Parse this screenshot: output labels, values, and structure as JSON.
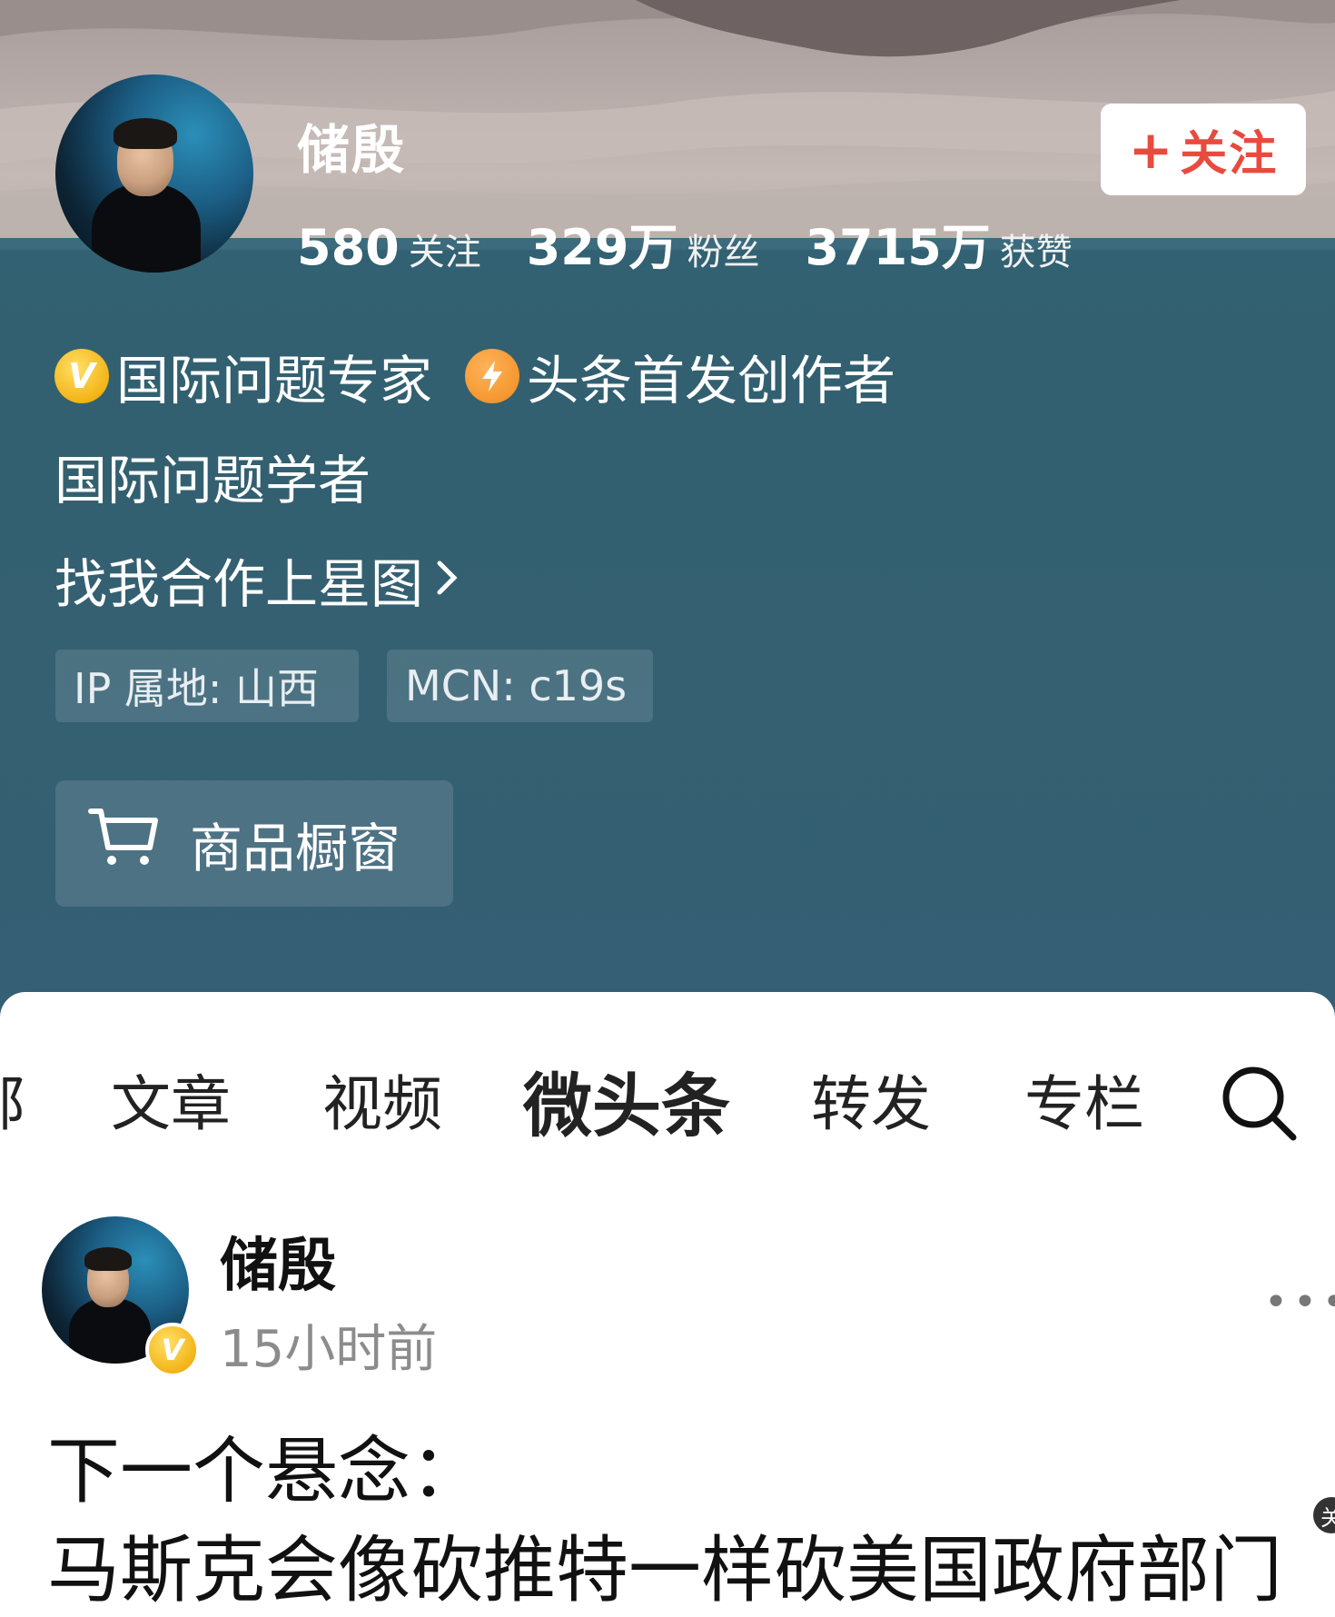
{
  "profile": {
    "name": "储殷",
    "follow_button": "关注",
    "follow_icon": "plus-icon",
    "stats": [
      {
        "num": "580",
        "unit": "",
        "label": "关注"
      },
      {
        "num": "329",
        "unit": "万",
        "label": "粉丝"
      },
      {
        "num": "3715",
        "unit": "万",
        "label": "获赞"
      }
    ],
    "badges": [
      {
        "icon": "verified-v-icon",
        "text": "国际问题专家"
      },
      {
        "icon": "lightning-icon",
        "text": "头条首发创作者"
      }
    ],
    "bio": "国际问题学者",
    "cooperation_link": "找我合作上星图",
    "tags": {
      "ip": "IP 属地: 山西",
      "mcn": "MCN: c19s"
    },
    "shop_button": "商品橱窗"
  },
  "tabs": {
    "items": [
      {
        "label": "部"
      },
      {
        "label": "文章"
      },
      {
        "label": "视频"
      },
      {
        "label": "微头条"
      },
      {
        "label": "转发"
      },
      {
        "label": "专栏"
      }
    ],
    "active": "微头条"
  },
  "post": {
    "author": "储殷",
    "time": "15小时前",
    "line1": "下一个悬念：",
    "line2": "马斯克会像砍推特一样砍美国政府部门"
  },
  "colors": {
    "header_bg": "#336070",
    "follow_accent": "#e94a3f",
    "badge_gold": "#f3b417",
    "badge_orange": "#f08b1d"
  }
}
